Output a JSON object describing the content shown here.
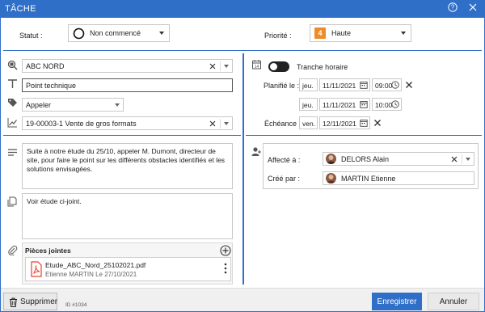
{
  "window": {
    "title": "TÂCHE"
  },
  "status": {
    "label": "Statut :",
    "value": "Non commencé"
  },
  "priority": {
    "label": "Priorité :",
    "value": "Haute",
    "badge": "4",
    "badge_color": "#f08c28"
  },
  "company": {
    "value": "ABC NORD"
  },
  "subject": {
    "value": "Point technique"
  },
  "type": {
    "value": "Appeler"
  },
  "deal": {
    "value": "19-00003-1 Vente de gros formats"
  },
  "schedule": {
    "toggle_label": "Tranche horaire",
    "planned_label": "Planifié le :",
    "start_day": "jeu.",
    "start_date": "11/11/2021",
    "start_time": "09:00",
    "end_day": "jeu.",
    "end_date": "11/11/2021",
    "end_time": "10:00",
    "due_label": "Échéance :",
    "due_day": "ven.",
    "due_date": "12/11/2021"
  },
  "description": {
    "text": "Suite à notre étude du 25/10, appeler M. Dumont, directeur de site, pour faire le point sur les différents obstacles identifiés et les solutions envisagées."
  },
  "note": {
    "text": "Voir étude ci-joint."
  },
  "attachments": {
    "title": "Pièces jointes",
    "items": [
      {
        "name": "Etude_ABC_Nord_25102021.pdf",
        "meta": "Etienne MARTIN Le 27/10/2021"
      }
    ]
  },
  "assignment": {
    "assigned_label": "Affecté à :",
    "assigned_value": "DELORS Alain",
    "created_label": "Créé par :",
    "created_value": "MARTIN Etienne"
  },
  "footer": {
    "delete_label": "Supprimer",
    "id_text": "ID #1034",
    "save_label": "Enregistrer",
    "cancel_label": "Annuler"
  },
  "colors": {
    "accent": "#2f6fc8",
    "pdf": "#e2442f"
  }
}
